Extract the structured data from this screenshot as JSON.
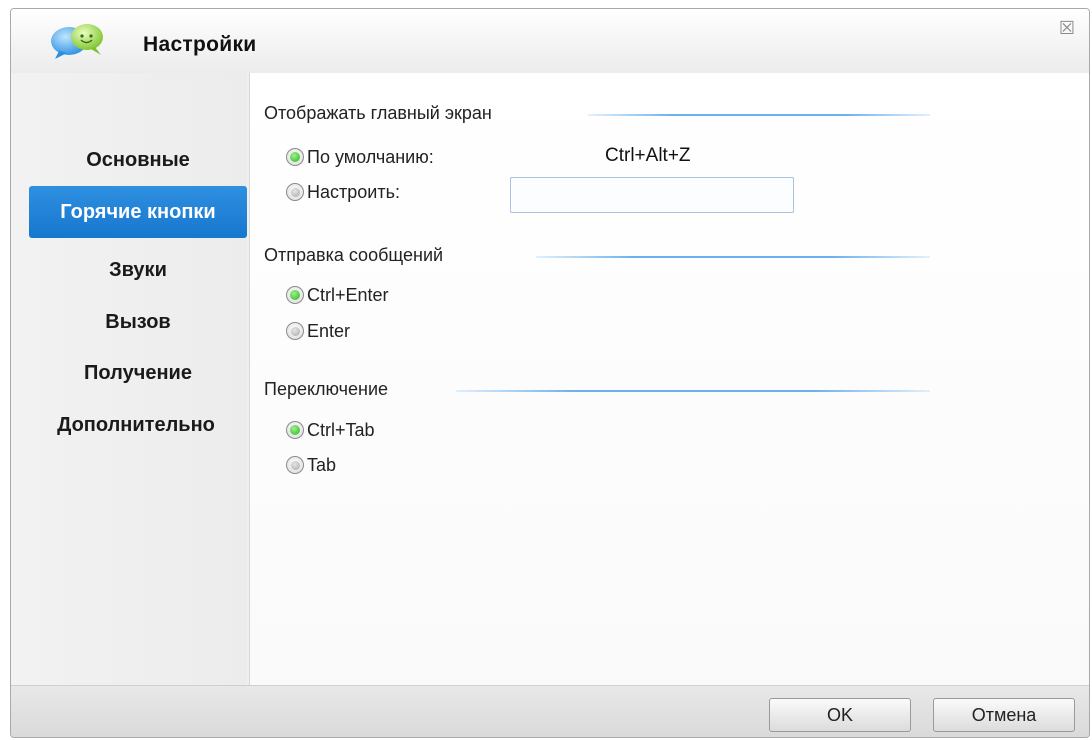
{
  "window": {
    "title": "Настройки",
    "close_glyph": "☒"
  },
  "sidebar": {
    "items": [
      {
        "label": "Основные"
      },
      {
        "label": "Горячие кнопки"
      },
      {
        "label": "Звуки"
      },
      {
        "label": "Вызов"
      },
      {
        "label": "Получение"
      },
      {
        "label": "Дополнительно"
      }
    ],
    "active_index": 1
  },
  "groups": {
    "show_main": {
      "title": "Отображать главный экран",
      "option_default": "По умолчанию:",
      "option_custom": "Настроить:",
      "default_shortcut": "Ctrl+Alt+Z",
      "custom_value": "",
      "selected": "default"
    },
    "send": {
      "title": "Отправка сообщений",
      "option1": "Ctrl+Enter",
      "option2": "Enter",
      "selected": "option1"
    },
    "switch": {
      "title": "Переключение",
      "option1": "Ctrl+Tab",
      "option2": "Tab",
      "selected": "option1"
    }
  },
  "footer": {
    "ok_label": "OK",
    "cancel_label": "Отмена"
  },
  "colors": {
    "accent": "#1d7fd6",
    "radio_on": "#24b624",
    "group_line": "#6bb0f0"
  },
  "icons": {
    "app": "chat-bubbles-icon",
    "close": "close-icon"
  }
}
